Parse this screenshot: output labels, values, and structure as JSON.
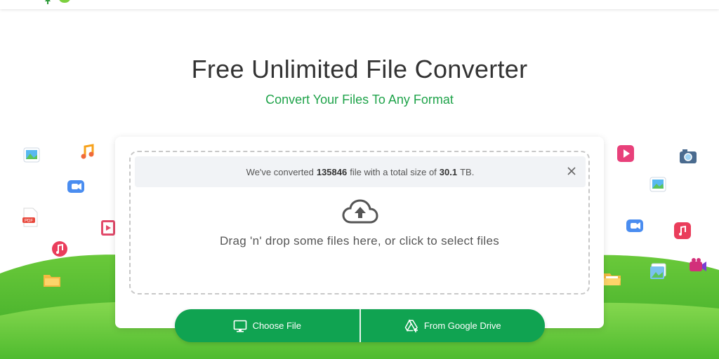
{
  "header": {
    "title": "Free Unlimited File Converter",
    "subtitle": "Convert Your Files To Any Format"
  },
  "banner": {
    "prefix": "We've converted",
    "file_count": "135846",
    "middle": "file with a total size of",
    "total_size": "30.1",
    "suffix": "TB."
  },
  "dropzone": {
    "instruction": "Drag 'n' drop some files here, or click to select files"
  },
  "buttons": {
    "choose_file": "Choose File",
    "google_drive": "From Google Drive"
  },
  "icons": {
    "upload": "cloud-upload-icon",
    "close": "close-icon",
    "monitor": "monitor-icon",
    "drive": "google-drive-icon"
  },
  "colors": {
    "brand_green": "#10a351",
    "subtitle_green": "#1fa34a",
    "hill_green": "#4cb72c"
  }
}
